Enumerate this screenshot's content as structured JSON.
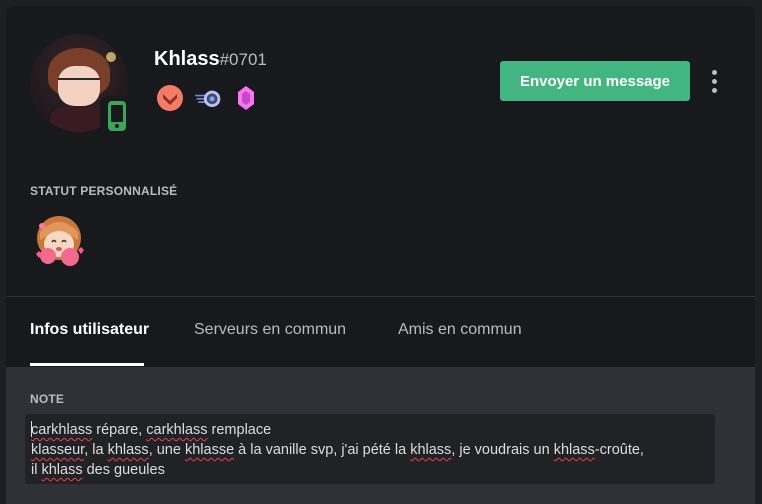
{
  "profile": {
    "username": "Khlass",
    "discriminator": "#0701",
    "status_device": "mobile",
    "badges": [
      {
        "icon": "hypesquad-bravery-icon",
        "color": "#f47b67"
      },
      {
        "icon": "early-supporter-icon",
        "color": "#7289da"
      },
      {
        "icon": "nitro-boost-icon",
        "color": "#ff73fa"
      }
    ]
  },
  "actions": {
    "send_message_label": "Envoyer un message"
  },
  "custom_status": {
    "title": "STATUT PERSONNALISÉ",
    "emoji": "anime-character-emoji"
  },
  "tabs": [
    {
      "label": "Infos utilisateur",
      "active": true
    },
    {
      "label": "Serveurs en commun",
      "active": false
    },
    {
      "label": "Amis en commun",
      "active": false
    }
  ],
  "note": {
    "title": "NOTE",
    "lines": [
      [
        {
          "text": "carkhlass",
          "spell": true
        },
        {
          "text": " répare, ",
          "spell": false
        },
        {
          "text": "carkhlass",
          "spell": true
        },
        {
          "text": " remplace",
          "spell": false
        }
      ],
      [
        {
          "text": "klasseur",
          "spell": true
        },
        {
          "text": ", la ",
          "spell": false
        },
        {
          "text": "khlass",
          "spell": true
        },
        {
          "text": ", une ",
          "spell": false
        },
        {
          "text": "khlasse",
          "spell": true
        },
        {
          "text": " à la vanille svp, j'ai pété la ",
          "spell": false
        },
        {
          "text": "khlass",
          "spell": true
        },
        {
          "text": ", je voudrais un ",
          "spell": false
        },
        {
          "text": "khlass",
          "spell": true
        },
        {
          "text": "-croûte,",
          "spell": false
        }
      ],
      [
        {
          "text": "il ",
          "spell": false
        },
        {
          "text": "khlass",
          "spell": true
        },
        {
          "text": " des gueules",
          "spell": false
        }
      ]
    ]
  },
  "colors": {
    "accent_green": "#43b581",
    "online_mobile": "#3ba55c",
    "background_dark": "#18191c",
    "background_body": "#2f3136",
    "spellcheck_red": "#ed4245"
  }
}
